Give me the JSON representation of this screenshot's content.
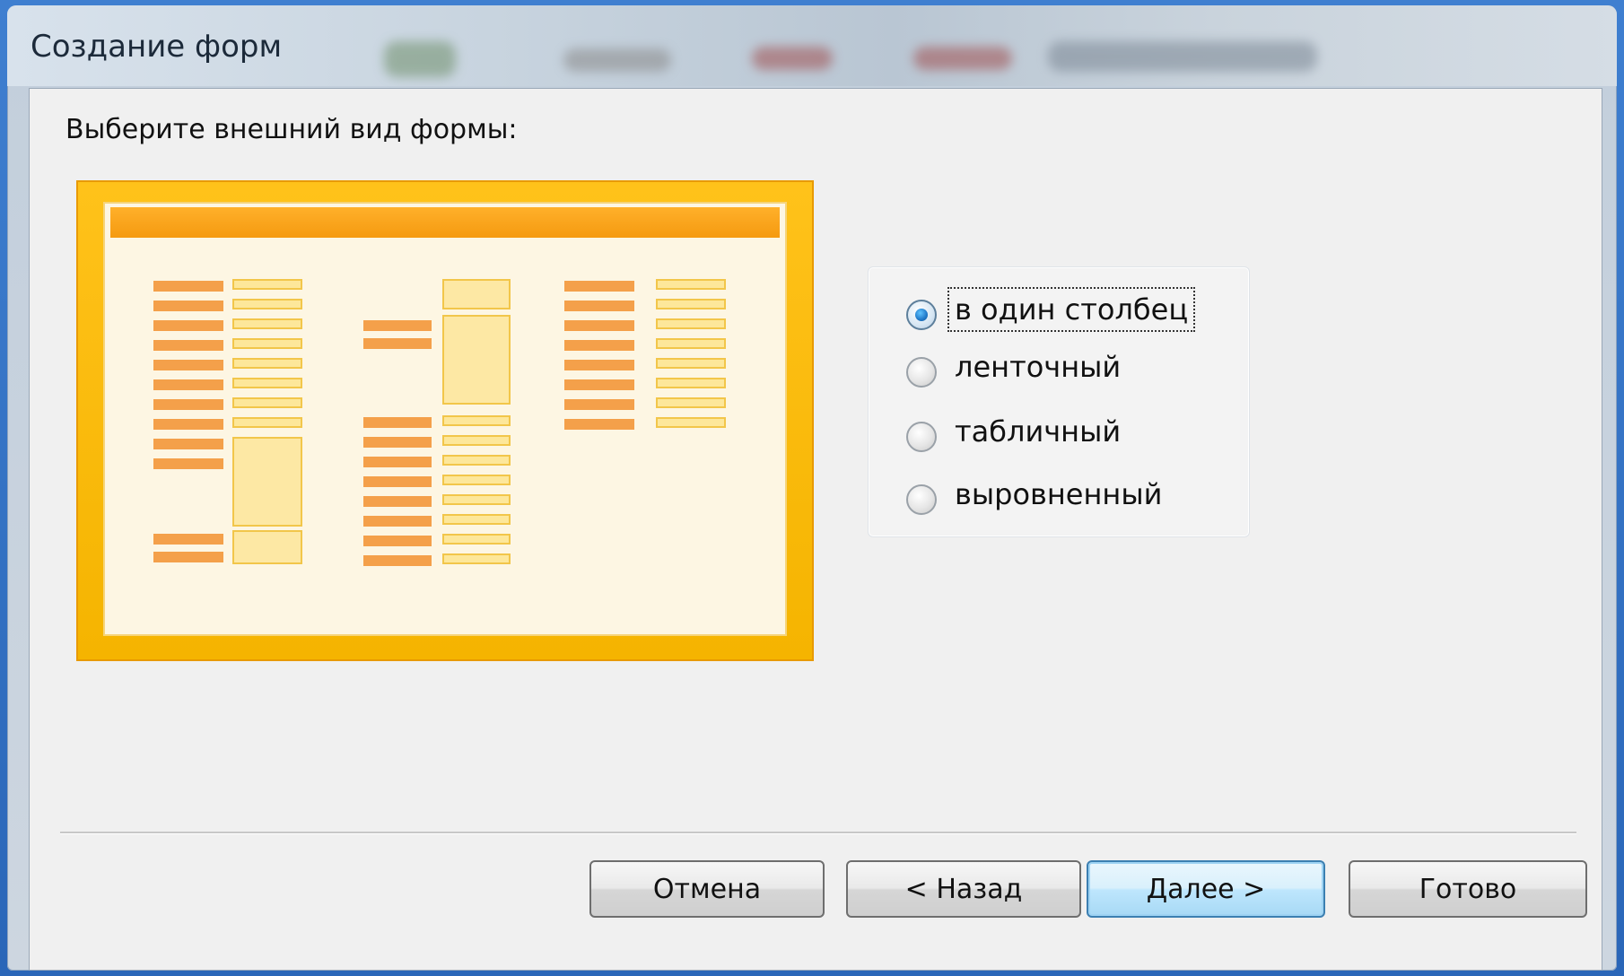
{
  "window": {
    "title": "Создание форм",
    "instruction": "Выберите внешний вид формы:"
  },
  "layout_options": [
    {
      "label": "в один столбец",
      "selected": true,
      "focused": true
    },
    {
      "label": "ленточный",
      "selected": false
    },
    {
      "label": "табличный",
      "selected": false
    },
    {
      "label": "выровненный",
      "selected": false
    }
  ],
  "preview": {
    "accent": "#f5a623",
    "label_color": "#f4a04a",
    "field_color": "#fde79a"
  },
  "buttons": {
    "cancel": "Отмена",
    "back": "< Назад",
    "next": "Далее >",
    "finish": "Готово"
  }
}
